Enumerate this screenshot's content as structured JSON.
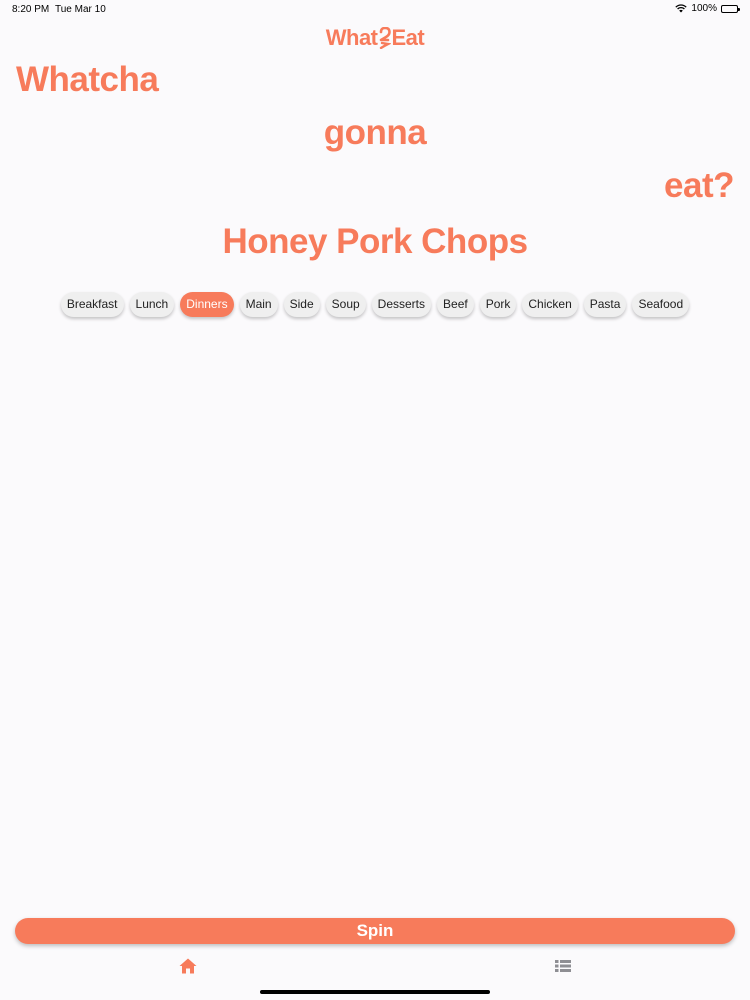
{
  "status_bar": {
    "time": "8:20 PM",
    "date": "Tue Mar 10",
    "battery": "100%",
    "battery_level": 1.0
  },
  "app": {
    "logo_before": "What",
    "logo_after": "Eat"
  },
  "headline": {
    "line1": "Whatcha",
    "line2": "gonna",
    "line3": "eat?"
  },
  "result": {
    "dish": "Honey Pork Chops"
  },
  "categories": {
    "items": [
      {
        "label": "Breakfast",
        "selected": false
      },
      {
        "label": "Lunch",
        "selected": false
      },
      {
        "label": "Dinners",
        "selected": true
      },
      {
        "label": "Main",
        "selected": false
      },
      {
        "label": "Side",
        "selected": false
      },
      {
        "label": "Soup",
        "selected": false
      },
      {
        "label": "Desserts",
        "selected": false
      },
      {
        "label": "Beef",
        "selected": false
      },
      {
        "label": "Pork",
        "selected": false
      },
      {
        "label": "Chicken",
        "selected": false
      },
      {
        "label": "Pasta",
        "selected": false
      },
      {
        "label": "Seafood",
        "selected": false
      }
    ]
  },
  "actions": {
    "spin_label": "Spin"
  },
  "tabs": {
    "home_icon": "home-icon",
    "list_icon": "list-icon"
  },
  "colors": {
    "accent": "#f77b5b",
    "active_tab": "#f77b5b",
    "inactive_tab": "#8e8e93",
    "background": "#fbfafc"
  }
}
